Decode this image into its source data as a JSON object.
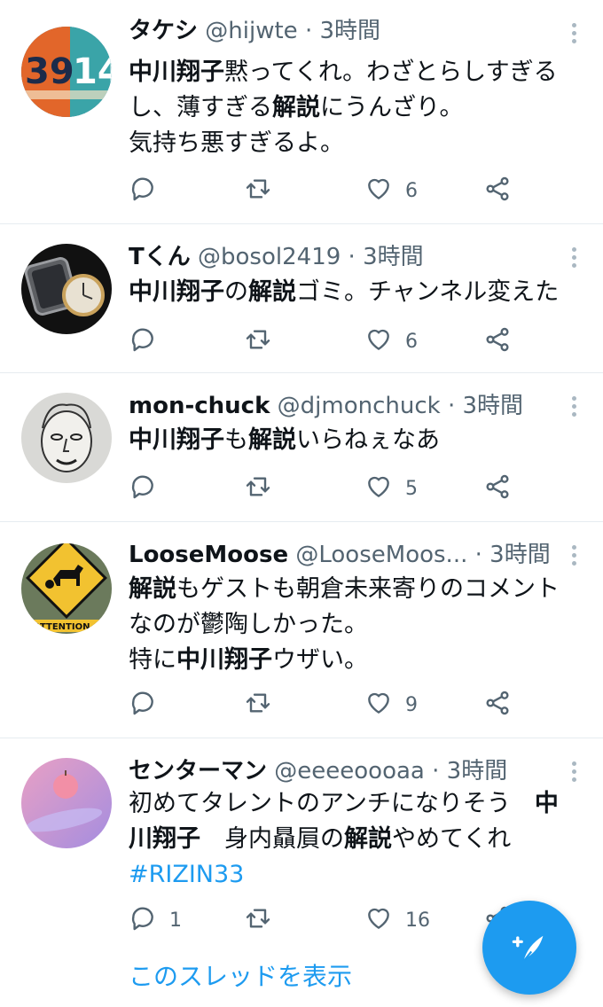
{
  "more_label": "",
  "tweets": [
    {
      "name": "タケシ",
      "handle": "@hijwte",
      "dot": "·",
      "time": "3時間",
      "lines": [
        [
          {
            "t": "中川翔子",
            "b": true
          },
          {
            "t": "黙ってくれ。わざとらしすぎる"
          }
        ],
        [
          {
            "t": "し、薄すぎる"
          },
          {
            "t": "解説",
            "b": true
          },
          {
            "t": "にうんざり。"
          }
        ],
        [
          {
            "t": "気持ち悪すぎるよ。"
          }
        ]
      ],
      "replies": "",
      "likes": "6",
      "avatar_icon": "jersey-avatar-icon"
    },
    {
      "name": "Tくん",
      "handle": "@bosol2419",
      "dot": "·",
      "time": "3時間",
      "lines": [
        [
          {
            "t": "中川翔子",
            "b": true
          },
          {
            "t": "の"
          },
          {
            "t": "解説",
            "b": true
          },
          {
            "t": "ゴミ。チャンネル変えた"
          }
        ]
      ],
      "replies": "",
      "likes": "6",
      "avatar_icon": "watch-avatar-icon"
    },
    {
      "name": "mon-chuck",
      "handle": "@djmonchuck",
      "dot": "·",
      "time": "3時間",
      "lines": [
        [
          {
            "t": "中川翔子",
            "b": true
          },
          {
            "t": "も"
          },
          {
            "t": "解説",
            "b": true
          },
          {
            "t": "いらねぇなあ"
          }
        ]
      ],
      "replies": "",
      "likes": "5",
      "avatar_icon": "face-drawing-avatar-icon"
    },
    {
      "name": "LooseMoose",
      "handle": "@LooseMoos...",
      "dot": "·",
      "time": "3時間",
      "lines": [
        [
          {
            "t": "解説",
            "b": true
          },
          {
            "t": "もゲストも朝倉未来寄りのコメント"
          }
        ],
        [
          {
            "t": "なのが鬱陶しかった。"
          }
        ],
        [
          {
            "t": "特に"
          },
          {
            "t": "中川翔子",
            "b": true
          },
          {
            "t": "ウザい。"
          }
        ]
      ],
      "replies": "",
      "likes": "9",
      "avatar_icon": "moose-sign-avatar-icon"
    },
    {
      "name": "センターマン",
      "handle": "@eeeeoooaa",
      "dot": "·",
      "time": "3時間",
      "lines": [
        [
          {
            "t": "初めてタレントのアンチになりそう　"
          },
          {
            "t": "中",
            "b": true
          }
        ],
        [
          {
            "t": "川翔子",
            "b": true
          },
          {
            "t": "　身内贔屓の"
          },
          {
            "t": "解説",
            "b": true
          },
          {
            "t": "やめてくれ"
          }
        ],
        [
          {
            "t": "#RIZIN33",
            "h": true
          }
        ]
      ],
      "replies": "1",
      "likes": "16",
      "avatar_icon": "apple-avatar-icon"
    }
  ],
  "thread_link": "このスレッドを表示",
  "fab_icon": "compose-tweet-icon",
  "colors": {
    "accent": "#1d9bf0",
    "muted": "#536471",
    "divider": "#e6ecf0"
  }
}
